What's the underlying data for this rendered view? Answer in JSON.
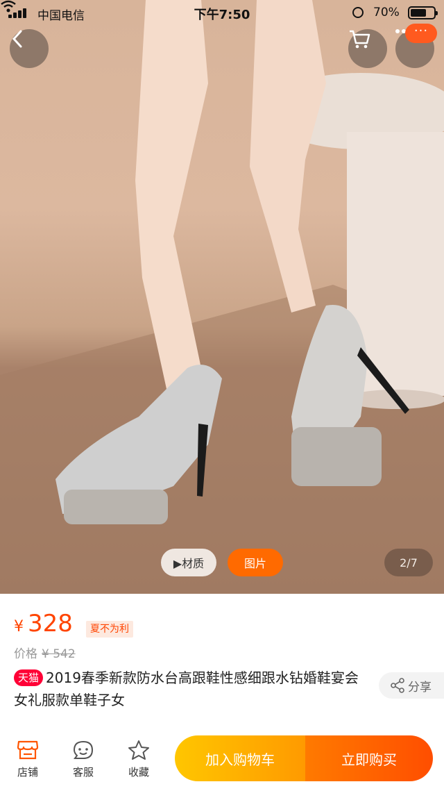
{
  "status_bar": {
    "carrier": "中国电信",
    "time": "下午7:50",
    "battery": "70%",
    "battery_level": 0.7
  },
  "hero": {
    "back_icon": "chevron-left-icon",
    "cart_icon": "cart-icon",
    "more_icon": "more-dots-icon",
    "more_badge": "···",
    "material_label": "▶材质",
    "photo_label": "图片",
    "pager": "2/7"
  },
  "product": {
    "currency": "¥",
    "price": "328",
    "promo": "夏不为利",
    "orig_label": "价格",
    "orig_price": "¥ 542",
    "tmall_badge": "天猫",
    "title": "2019春季新款防水台高跟鞋性感细跟水钻婚鞋宴会女礼服款单鞋子女",
    "share_label": "分享"
  },
  "bottom_bar": {
    "shop_label": "店铺",
    "service_label": "客服",
    "favorite_label": "收藏",
    "add_cart_label": "加入购物车",
    "buy_now_label": "立即购买"
  },
  "colors": {
    "accent": "#ff4400",
    "tmall": "#ff0036",
    "cart_gradient": [
      "#ffc600",
      "#ff9a00"
    ],
    "buy_gradient": [
      "#ff7a00",
      "#ff4e00"
    ]
  }
}
